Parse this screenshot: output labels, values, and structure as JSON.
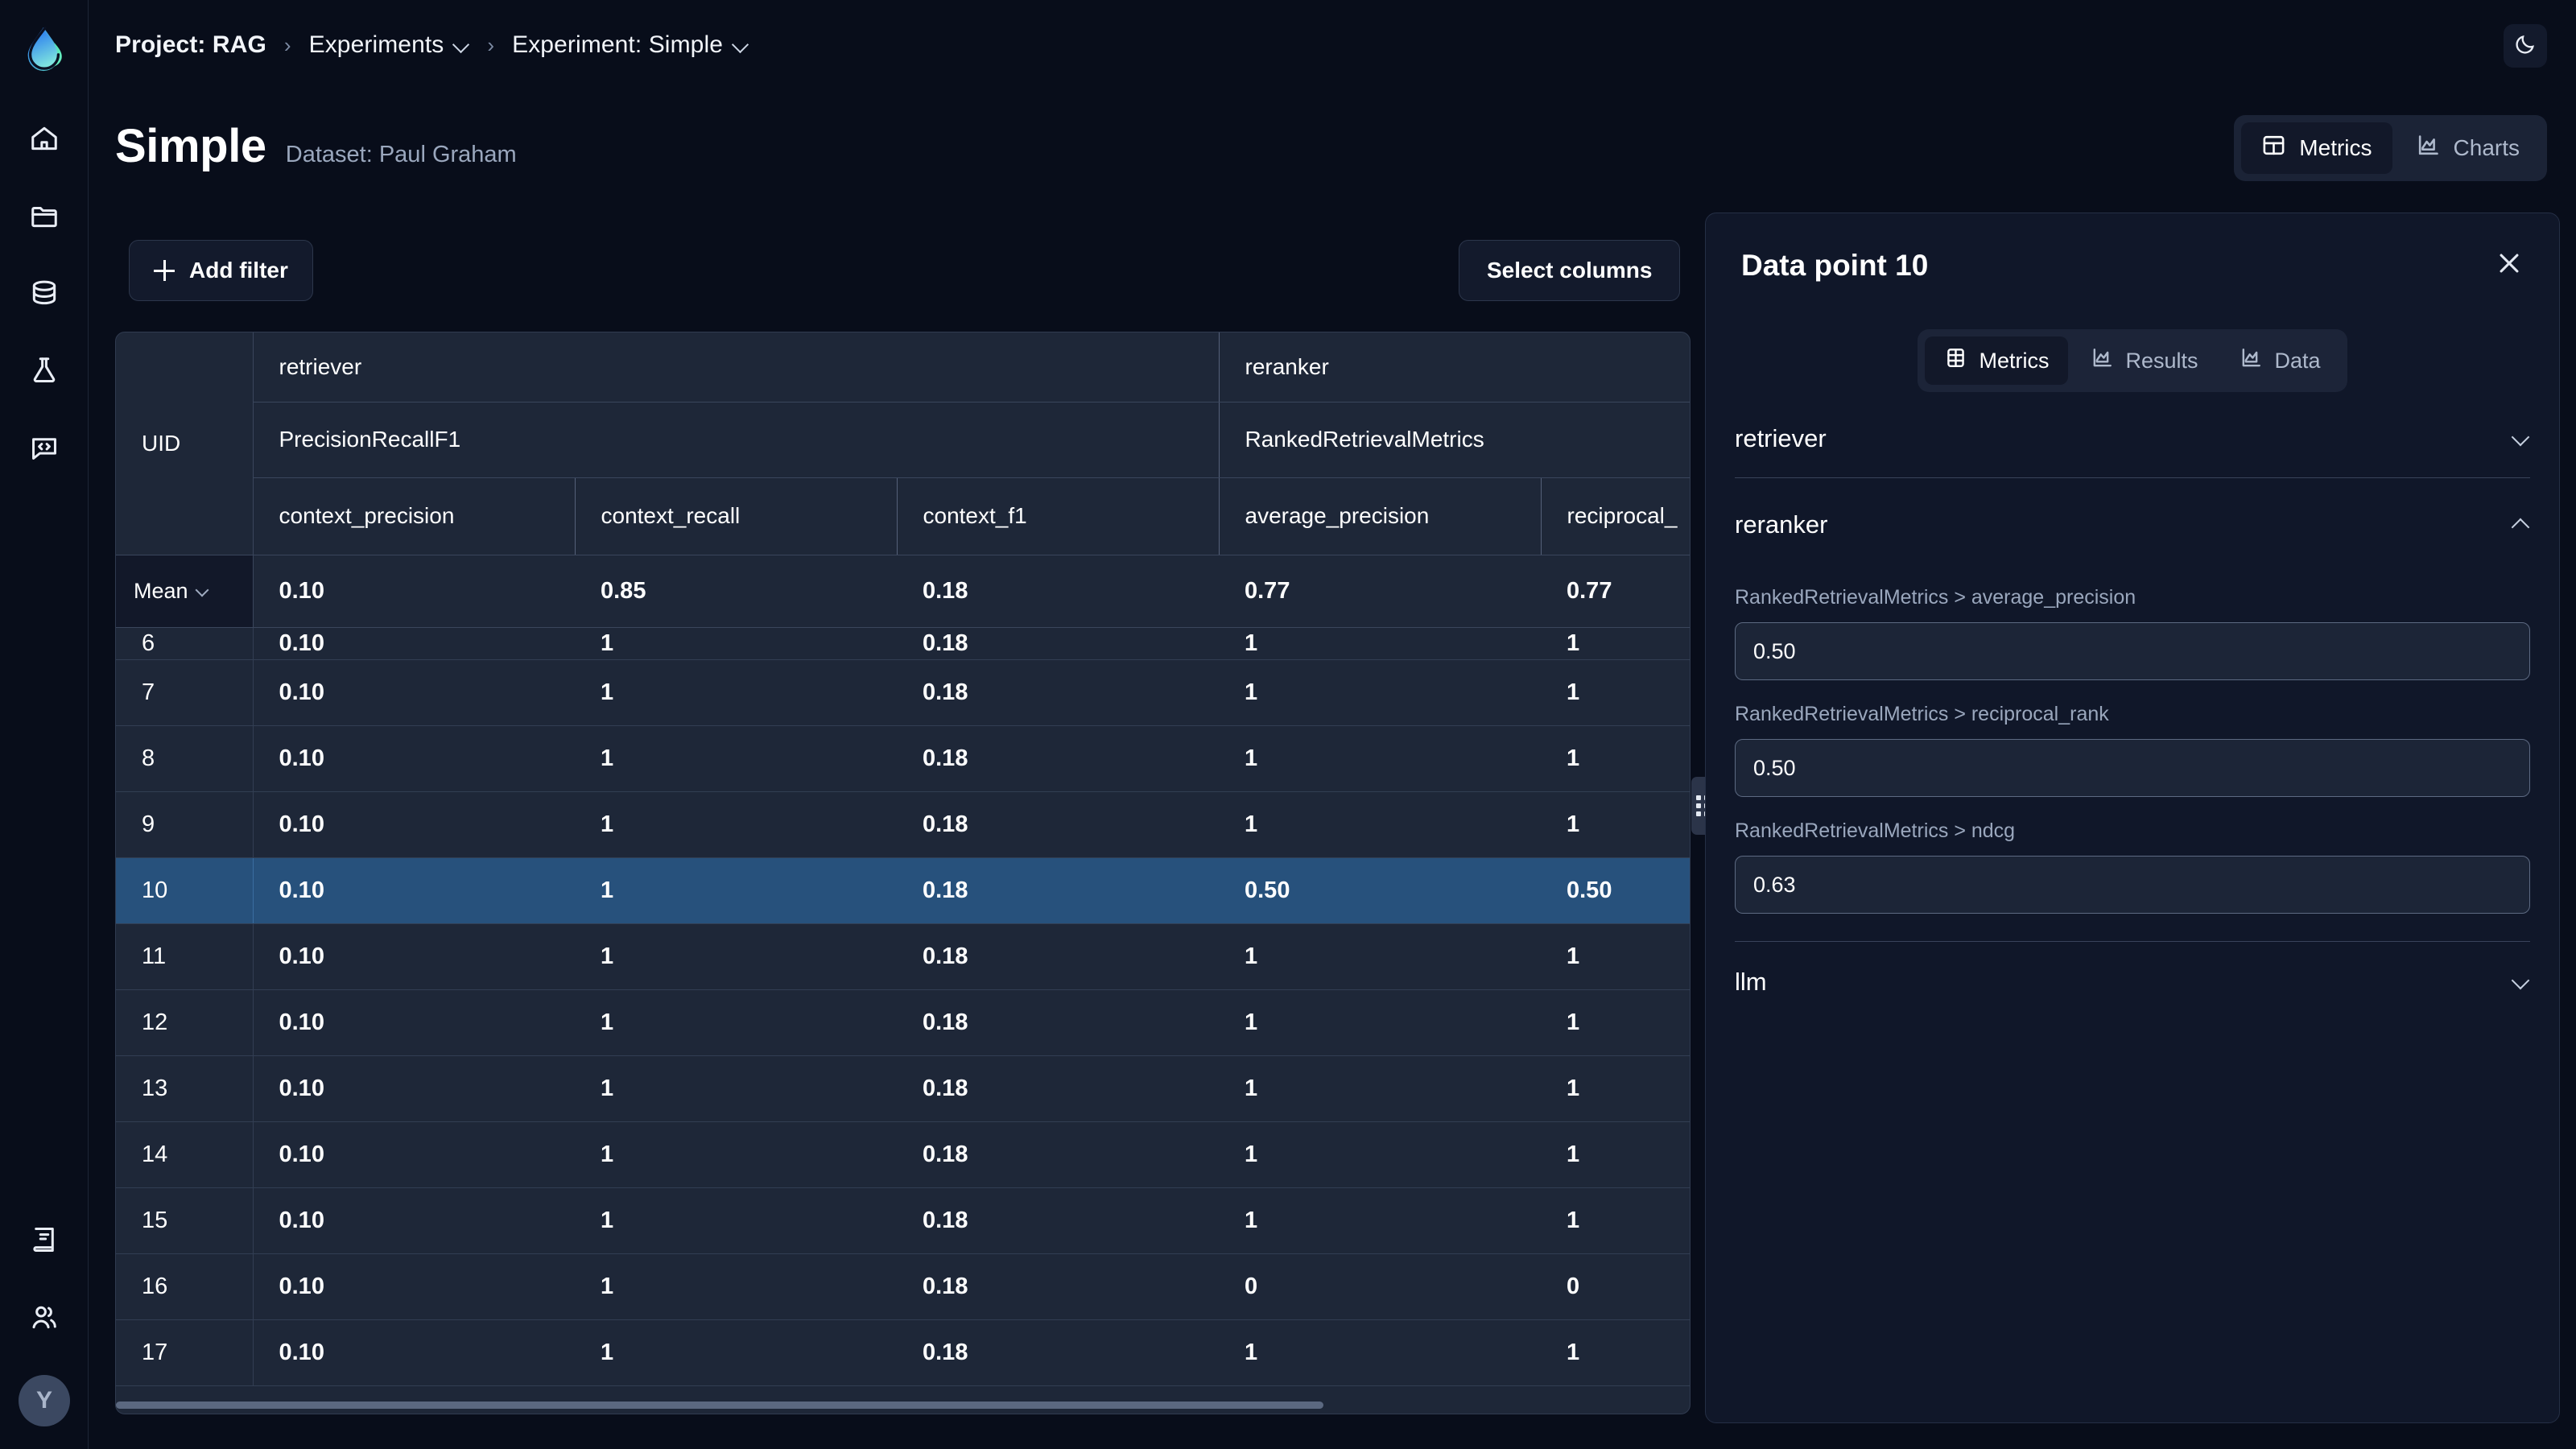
{
  "app": {
    "logo_icon": "droplet-logo",
    "theme_toggle_icon": "moon-icon",
    "avatar_initial": "Y"
  },
  "rail": {
    "items": [
      {
        "icon": "home-icon",
        "name": "home"
      },
      {
        "icon": "folder-icon",
        "name": "projects"
      },
      {
        "icon": "database-icon",
        "name": "datasets"
      },
      {
        "icon": "flask-icon",
        "name": "experiments"
      },
      {
        "icon": "code-chat-icon",
        "name": "prompts"
      }
    ],
    "bottom_items": [
      {
        "icon": "book-icon",
        "name": "docs"
      },
      {
        "icon": "users-icon",
        "name": "team"
      }
    ]
  },
  "breadcrumb": {
    "items": [
      {
        "label": "Project: RAG",
        "bold": true,
        "has_chevron": false
      },
      {
        "label": "Experiments",
        "bold": false,
        "has_chevron": true
      },
      {
        "label": "Experiment: Simple",
        "bold": false,
        "has_chevron": true
      }
    ],
    "separator": "›"
  },
  "header": {
    "title": "Simple",
    "dataset": "Dataset: Paul Graham"
  },
  "view_toggle": {
    "options": [
      {
        "label": "Metrics",
        "icon": "table-icon",
        "active": true
      },
      {
        "label": "Charts",
        "icon": "chart-icon",
        "active": false
      }
    ]
  },
  "actions": {
    "add_filter": "Add filter",
    "add_filter_icon": "plus-icon",
    "select_columns": "Select columns"
  },
  "table": {
    "uid_header": "UID",
    "group_row": [
      {
        "label": "retriever",
        "span": 3
      },
      {
        "label": "reranker",
        "span": 2
      }
    ],
    "metric_class_row": [
      {
        "label": "PrecisionRecallF1",
        "span": 3
      },
      {
        "label": "RankedRetrievalMetrics",
        "span": 2
      }
    ],
    "columns": [
      "context_precision",
      "context_recall",
      "context_f1",
      "average_precision",
      "reciprocal_"
    ],
    "mean_row": {
      "label": "Mean",
      "values": [
        "0.10",
        "0.85",
        "0.18",
        "0.77",
        "0.77"
      ]
    },
    "rows": [
      {
        "uid": "6",
        "values": [
          "0.10",
          "1",
          "0.18",
          "1",
          "1"
        ],
        "selected": false,
        "clipped": true
      },
      {
        "uid": "7",
        "values": [
          "0.10",
          "1",
          "0.18",
          "1",
          "1"
        ],
        "selected": false
      },
      {
        "uid": "8",
        "values": [
          "0.10",
          "1",
          "0.18",
          "1",
          "1"
        ],
        "selected": false
      },
      {
        "uid": "9",
        "values": [
          "0.10",
          "1",
          "0.18",
          "1",
          "1"
        ],
        "selected": false
      },
      {
        "uid": "10",
        "values": [
          "0.10",
          "1",
          "0.18",
          "0.50",
          "0.50"
        ],
        "selected": true
      },
      {
        "uid": "11",
        "values": [
          "0.10",
          "1",
          "0.18",
          "1",
          "1"
        ],
        "selected": false
      },
      {
        "uid": "12",
        "values": [
          "0.10",
          "1",
          "0.18",
          "1",
          "1"
        ],
        "selected": false
      },
      {
        "uid": "13",
        "values": [
          "0.10",
          "1",
          "0.18",
          "1",
          "1"
        ],
        "selected": false
      },
      {
        "uid": "14",
        "values": [
          "0.10",
          "1",
          "0.18",
          "1",
          "1"
        ],
        "selected": false
      },
      {
        "uid": "15",
        "values": [
          "0.10",
          "1",
          "0.18",
          "1",
          "1"
        ],
        "selected": false
      },
      {
        "uid": "16",
        "values": [
          "0.10",
          "1",
          "0.18",
          "0",
          "0"
        ],
        "selected": false
      },
      {
        "uid": "17",
        "values": [
          "0.10",
          "1",
          "0.18",
          "1",
          "1"
        ],
        "selected": false
      }
    ]
  },
  "panel": {
    "title": "Data point 10",
    "close_icon": "close-icon",
    "tabs": [
      {
        "label": "Metrics",
        "icon": "table-icon",
        "active": true
      },
      {
        "label": "Results",
        "icon": "chart-icon",
        "active": false
      },
      {
        "label": "Data",
        "icon": "chart-icon",
        "active": false
      }
    ],
    "sections": [
      {
        "label": "retriever",
        "expanded": false
      },
      {
        "label": "reranker",
        "expanded": true
      },
      {
        "label": "llm",
        "expanded": false
      }
    ],
    "fields": [
      {
        "label": "RankedRetrievalMetrics > average_precision",
        "value": "0.50"
      },
      {
        "label": "RankedRetrievalMetrics > reciprocal_rank",
        "value": "0.50"
      },
      {
        "label": "RankedRetrievalMetrics > ndcg",
        "value": "0.63"
      }
    ]
  },
  "colors": {
    "background": "#080d1a",
    "surface": "#1e2738",
    "panel": "#101729",
    "selected_row": "#27517c",
    "accent_text": "#ffffff",
    "muted_text": "#9aa7bd"
  }
}
